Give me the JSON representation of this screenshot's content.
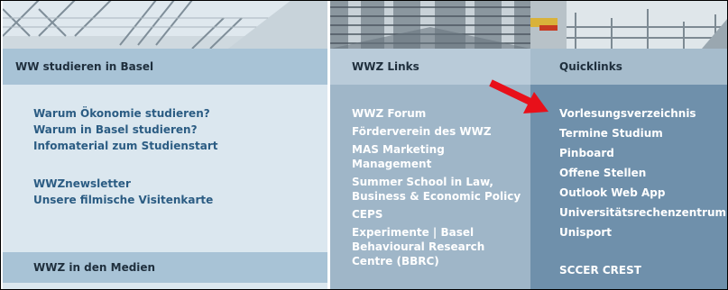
{
  "columns": [
    {
      "header": "WW studieren in Basel",
      "links": [
        "Warum Ökonomie studieren?",
        "Warum in Basel studieren?",
        "Infomaterial zum Studienstart",
        "WWZnewsletter",
        "Unsere filmische Visitenkarte"
      ],
      "media_bar": "WWZ in den Medien"
    },
    {
      "header": "WWZ Links",
      "links": [
        "WWZ Forum",
        "Förderverein des WWZ",
        "MAS Marketing",
        "Management",
        "Summer School in Law,",
        "Business & Economic Policy",
        "CEPS",
        "Experimente | Basel",
        "Behavioural Research",
        "Centre (BBRC)"
      ]
    },
    {
      "header": "Quicklinks",
      "links": [
        "Vorlesungsverzeichnis",
        "Termine Studium",
        "Pinboard",
        "Offene Stellen",
        "Outlook Web App",
        "Universitätsrechenzentrum",
        "Unisport",
        "SCCER CREST"
      ]
    }
  ],
  "colors": {
    "col1_bg": "#dbe7ef",
    "col2_bg": "#9fb6c8",
    "col3_bg": "#6f90ab",
    "link_blue": "#2b5c83",
    "arrow_red": "#e8101a"
  }
}
